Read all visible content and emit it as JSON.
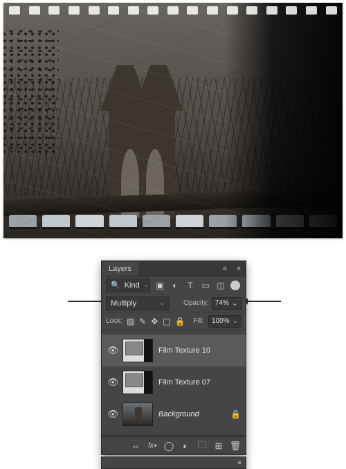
{
  "panel": {
    "title": "Layers",
    "filter": {
      "kind_label": "Kind"
    },
    "blend_mode": "Multiply",
    "opacity": {
      "label": "Opacity:",
      "value": "74%"
    },
    "lock": {
      "label": "Lock:"
    },
    "fill": {
      "label": "Fill:",
      "value": "100%"
    },
    "layers": [
      {
        "name": "Film Texture 10",
        "visible": true,
        "selected": true,
        "locked": false
      },
      {
        "name": "Film Texture 07",
        "visible": true,
        "selected": false,
        "locked": false
      },
      {
        "name": "Background",
        "visible": true,
        "selected": false,
        "locked": true,
        "italic": true
      }
    ],
    "filter_icons": [
      "image-icon",
      "adjustment-icon",
      "type-icon",
      "shape-icon",
      "smartobj-icon",
      "dot-icon"
    ],
    "lock_icons": [
      "lock-transparency-icon",
      "lock-brush-icon",
      "lock-move-icon",
      "lock-artboard-icon",
      "lock-all-icon"
    ],
    "footer_icons": [
      "link-icon",
      "fx-icon",
      "mask-icon",
      "adjustment-layer-icon",
      "group-icon",
      "new-layer-icon",
      "trash-icon"
    ]
  }
}
